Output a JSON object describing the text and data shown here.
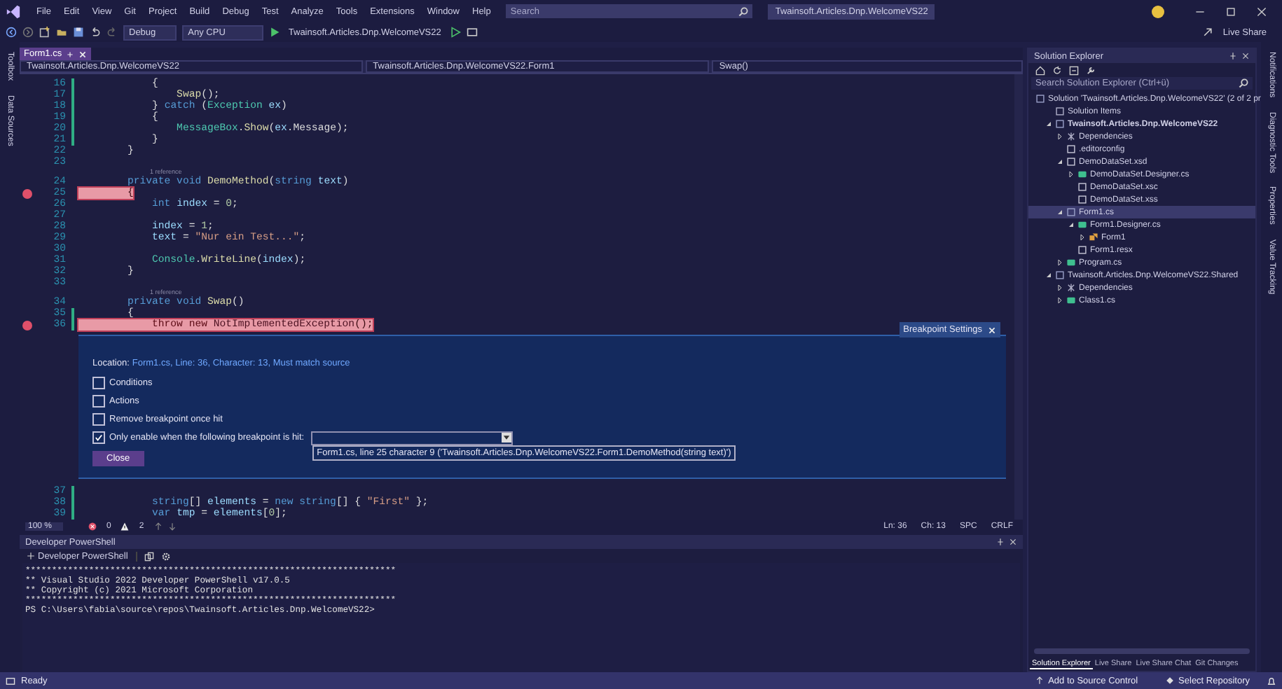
{
  "menu_bar": {
    "items": [
      "File",
      "Edit",
      "View",
      "Git",
      "Project",
      "Build",
      "Debug",
      "Test",
      "Analyze",
      "Tools",
      "Extensions",
      "Window",
      "Help"
    ],
    "search": {
      "placeholder": "Search"
    },
    "title": "Twainsoft.Articles.Dnp.WelcomeVS22"
  },
  "toolbar": {
    "configuration": "Debug",
    "platform": "Any CPU",
    "start_target": "Twainsoft.Articles.Dnp.WelcomeVS22",
    "live_share": "Live Share"
  },
  "left_tool_tabs": [
    "Toolbox",
    "Data Sources"
  ],
  "right_tool_tabs": [
    "Notifications",
    "Diagnostic Tools",
    "Properties",
    "Value Tracking"
  ],
  "editor": {
    "tabs": [
      {
        "label": "Form1.cs",
        "selected": true
      }
    ],
    "navigation": [
      "Twainsoft.Articles.Dnp.WelcomeVS22",
      "Twainsoft.Articles.Dnp.WelcomeVS22.Form1",
      "Swap()"
    ],
    "lines": [
      {
        "kind": "code",
        "number": "16",
        "breakpoint": false,
        "changed": true,
        "tokens": [
          {
            "kind": "plain",
            "text": "            {"
          }
        ]
      },
      {
        "kind": "code",
        "number": "17",
        "breakpoint": false,
        "changed": true,
        "tokens": [
          {
            "kind": "method",
            "text": "                Swap"
          },
          {
            "kind": "plain",
            "text": "();"
          }
        ]
      },
      {
        "kind": "code",
        "number": "18",
        "breakpoint": false,
        "changed": true,
        "tokens": [
          {
            "kind": "plain",
            "text": "            } "
          },
          {
            "kind": "keyword",
            "text": "catch"
          },
          {
            "kind": "plain",
            "text": " ("
          },
          {
            "kind": "type",
            "text": "Exception"
          },
          {
            "kind": "variable",
            "text": " ex"
          },
          {
            "kind": "plain",
            "text": ")"
          }
        ]
      },
      {
        "kind": "code",
        "number": "19",
        "breakpoint": false,
        "changed": true,
        "tokens": [
          {
            "kind": "plain",
            "text": "            {"
          }
        ]
      },
      {
        "kind": "code",
        "number": "20",
        "breakpoint": false,
        "changed": true,
        "tokens": [
          {
            "kind": "type",
            "text": "                MessageBox"
          },
          {
            "kind": "plain",
            "text": "."
          },
          {
            "kind": "method",
            "text": "Show"
          },
          {
            "kind": "plain",
            "text": "("
          },
          {
            "kind": "variable",
            "text": "ex"
          },
          {
            "kind": "plain",
            "text": ".Message);"
          }
        ]
      },
      {
        "kind": "code",
        "number": "21",
        "breakpoint": false,
        "changed": true,
        "tokens": [
          {
            "kind": "plain",
            "text": "            }"
          }
        ]
      },
      {
        "kind": "code",
        "number": "22",
        "breakpoint": false,
        "changed": false,
        "tokens": [
          {
            "kind": "plain",
            "text": "        }"
          }
        ]
      },
      {
        "kind": "code",
        "number": "23",
        "breakpoint": false,
        "changed": false
      },
      {
        "kind": "codelens",
        "text": "1 reference"
      },
      {
        "kind": "code",
        "number": "24",
        "breakpoint": false,
        "changed": false,
        "tokens": [
          {
            "kind": "keyword",
            "text": "        private void "
          },
          {
            "kind": "method",
            "text": "DemoMethod"
          },
          {
            "kind": "plain",
            "text": "("
          },
          {
            "kind": "keyword",
            "text": "string "
          },
          {
            "kind": "variable",
            "text": "text"
          },
          {
            "kind": "plain",
            "text": ")"
          }
        ]
      },
      {
        "kind": "code",
        "number": "25",
        "breakpoint": true,
        "changed": false,
        "tokens": [
          {
            "kind": "plain",
            "text": "        {"
          }
        ]
      },
      {
        "kind": "code",
        "number": "26",
        "breakpoint": false,
        "changed": false,
        "tokens": [
          {
            "kind": "keyword",
            "text": "            int "
          },
          {
            "kind": "variable",
            "text": "index"
          },
          {
            "kind": "plain",
            "text": " = "
          },
          {
            "kind": "number",
            "text": "0"
          },
          {
            "kind": "plain",
            "text": ";"
          }
        ]
      },
      {
        "kind": "code",
        "number": "27",
        "breakpoint": false,
        "changed": false
      },
      {
        "kind": "code",
        "number": "28",
        "breakpoint": false,
        "changed": false,
        "tokens": [
          {
            "kind": "variable",
            "text": "            index"
          },
          {
            "kind": "plain",
            "text": " = "
          },
          {
            "kind": "number",
            "text": "1"
          },
          {
            "kind": "plain",
            "text": ";"
          }
        ]
      },
      {
        "kind": "code",
        "number": "29",
        "breakpoint": false,
        "changed": false,
        "tokens": [
          {
            "kind": "variable",
            "text": "            text"
          },
          {
            "kind": "plain",
            "text": " = "
          },
          {
            "kind": "string",
            "text": "\"Nur ein Test...\""
          },
          {
            "kind": "plain",
            "text": ";"
          }
        ]
      },
      {
        "kind": "code",
        "number": "30",
        "breakpoint": false,
        "changed": false
      },
      {
        "kind": "code",
        "number": "31",
        "breakpoint": false,
        "changed": false,
        "tokens": [
          {
            "kind": "type",
            "text": "            Console"
          },
          {
            "kind": "plain",
            "text": "."
          },
          {
            "kind": "method",
            "text": "WriteLine"
          },
          {
            "kind": "plain",
            "text": "("
          },
          {
            "kind": "variable",
            "text": "index"
          },
          {
            "kind": "plain",
            "text": ");"
          }
        ]
      },
      {
        "kind": "code",
        "number": "32",
        "breakpoint": false,
        "changed": false,
        "tokens": [
          {
            "kind": "plain",
            "text": "        }"
          }
        ]
      },
      {
        "kind": "code",
        "number": "33",
        "breakpoint": false,
        "changed": false
      },
      {
        "kind": "codelens",
        "text": "1 reference"
      },
      {
        "kind": "code",
        "number": "34",
        "breakpoint": false,
        "changed": false,
        "tokens": [
          {
            "kind": "keyword",
            "text": "        private void "
          },
          {
            "kind": "method",
            "text": "Swap"
          },
          {
            "kind": "plain",
            "text": "()"
          }
        ]
      },
      {
        "kind": "code",
        "number": "35",
        "breakpoint": false,
        "changed": true,
        "tokens": [
          {
            "kind": "plain",
            "text": "        {"
          }
        ]
      },
      {
        "kind": "code",
        "number": "36",
        "breakpoint": true,
        "changed": true,
        "tokens": [
          {
            "kind": "keyword",
            "text": "            throw new "
          },
          {
            "kind": "type",
            "text": "NotImplementedException"
          },
          {
            "kind": "plain",
            "text": "();"
          }
        ]
      }
    ],
    "breakpoint_settings": {
      "title": "Breakpoint Settings",
      "location_label": "Location:",
      "location": "Form1.cs, Line: 36, Character: 13, Must match source",
      "options": [
        {
          "label": "Conditions",
          "checked": false
        },
        {
          "label": "Actions",
          "checked": false
        },
        {
          "label": "Remove breakpoint once hit",
          "checked": false
        },
        {
          "label": "Only enable when the following breakpoint is hit:",
          "checked": true
        }
      ],
      "dependency_option": "Form1.cs, line 25 character 9 ('Twainsoft.Articles.Dnp.WelcomeVS22.Form1.DemoMethod(string text)')",
      "close": "Close"
    },
    "lines_after": [
      {
        "kind": "code",
        "number": "37",
        "breakpoint": false,
        "changed": true
      },
      {
        "kind": "code",
        "number": "38",
        "breakpoint": false,
        "changed": true,
        "tokens": [
          {
            "kind": "keyword",
            "text": "            string"
          },
          {
            "kind": "plain",
            "text": "[] "
          },
          {
            "kind": "variable",
            "text": "elements"
          },
          {
            "kind": "plain",
            "text": " = "
          },
          {
            "kind": "keyword",
            "text": "new string"
          },
          {
            "kind": "plain",
            "text": "[] { "
          },
          {
            "kind": "string",
            "text": "\"First\""
          },
          {
            "kind": "plain",
            "text": " };"
          }
        ]
      },
      {
        "kind": "code",
        "number": "39",
        "breakpoint": false,
        "changed": true,
        "tokens": [
          {
            "kind": "keyword",
            "text": "            var "
          },
          {
            "kind": "variable",
            "text": "tmp"
          },
          {
            "kind": "plain",
            "text": " = "
          },
          {
            "kind": "variable",
            "text": "elements"
          },
          {
            "kind": "plain",
            "text": "["
          },
          {
            "kind": "number",
            "text": "0"
          },
          {
            "kind": "plain",
            "text": "];"
          }
        ]
      }
    ],
    "status": {
      "zoom": "100 %",
      "errors": "0",
      "warnings": "2",
      "line": "Ln: 36",
      "column": "Ch: 13",
      "whitespace": "SPC",
      "line_ending": "CRLF"
    }
  },
  "powershell": {
    "title": "Developer PowerShell",
    "profile": "Developer PowerShell",
    "output": [
      "**********************************************************************",
      "** Visual Studio 2022 Developer PowerShell v17.0.5",
      "** Copyright (c) 2021 Microsoft Corporation",
      "**********************************************************************",
      "PS C:\\Users\\fabia\\source\\repos\\Twainsoft.Articles.Dnp.WelcomeVS22>"
    ]
  },
  "solution_explorer": {
    "title": "Solution Explorer",
    "search": {
      "placeholder": "Search Solution Explorer (Ctrl+ü)"
    },
    "tree": [
      {
        "label": "Solution 'Twainsoft.Articles.Dnp.WelcomeVS22' (2 of 2 pr",
        "kind": "solution",
        "selected": false,
        "children": [
          {
            "label": "Solution Items",
            "kind": "folder",
            "selected": false
          },
          {
            "label": "Twainsoft.Articles.Dnp.WelcomeVS22",
            "kind": "project",
            "bold": true,
            "expanded": true,
            "selected": false,
            "children": [
              {
                "label": "Dependencies",
                "kind": "dependencies",
                "expanded": false,
                "selected": false
              },
              {
                "label": ".editorconfig",
                "kind": "file",
                "selected": false
              },
              {
                "label": "DemoDataSet.xsd",
                "kind": "dataset",
                "expanded": true,
                "selected": false,
                "children": [
                  {
                    "label": "DemoDataSet.Designer.cs",
                    "kind": "code",
                    "expanded": false,
                    "selected": false
                  },
                  {
                    "label": "DemoDataSet.xsc",
                    "kind": "file",
                    "selected": false
                  },
                  {
                    "label": "DemoDataSet.xss",
                    "kind": "dataset",
                    "selected": false
                  }
                ]
              },
              {
                "label": "Form1.cs",
                "kind": "form",
                "expanded": true,
                "selected": true,
                "children": [
                  {
                    "label": "Form1.Designer.cs",
                    "kind": "code",
                    "expanded": true,
                    "selected": false,
                    "children": [
                      {
                        "label": "Form1",
                        "kind": "class",
                        "expanded": false,
                        "selected": false
                      }
                    ]
                  },
                  {
                    "label": "Form1.resx",
                    "kind": "file",
                    "selected": false
                  }
                ]
              },
              {
                "label": "Program.cs",
                "kind": "code",
                "expanded": false,
                "selected": false
              }
            ]
          },
          {
            "label": "Twainsoft.Articles.Dnp.WelcomeVS22.Shared",
            "kind": "project",
            "bold": false,
            "expanded": true,
            "selected": false,
            "children": [
              {
                "label": "Dependencies",
                "kind": "dependencies",
                "expanded": false,
                "selected": false
              },
              {
                "label": "Class1.cs",
                "kind": "code",
                "expanded": false,
                "selected": false
              }
            ]
          }
        ]
      }
    ],
    "tabs": [
      {
        "label": "Solution Explorer",
        "selected": true
      },
      {
        "label": "Live Share",
        "selected": false
      },
      {
        "label": "Live Share Chat",
        "selected": false
      },
      {
        "label": "Git Changes",
        "selected": false
      }
    ]
  },
  "status_bar": {
    "message": "Ready",
    "source_control": "Add to Source Control",
    "repository": "Select Repository"
  }
}
